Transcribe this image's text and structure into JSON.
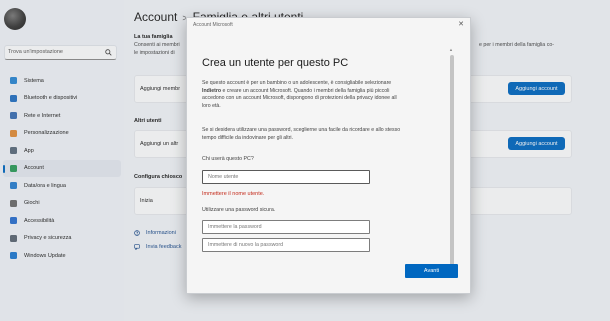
{
  "sidebar": {
    "search_placeholder": "Trova un'impostazione",
    "items": [
      {
        "label": "Sistema",
        "icon": "monitor-icon",
        "color": "#2b87d3"
      },
      {
        "label": "Bluetooth e dispositivi",
        "icon": "bluetooth-icon",
        "color": "#2470c2"
      },
      {
        "label": "Rete e Internet",
        "icon": "wifi-icon",
        "color": "#3b6fb3"
      },
      {
        "label": "Personalizzazione",
        "icon": "brush-icon",
        "color": "#e08c3a"
      },
      {
        "label": "App",
        "icon": "apps-icon",
        "color": "#5b6b7d"
      },
      {
        "label": "Account",
        "icon": "person-icon",
        "color": "#2d9b5a",
        "active": true
      },
      {
        "label": "Data/ora e lingua",
        "icon": "globe-clock-icon",
        "color": "#2a7fd0"
      },
      {
        "label": "Giochi",
        "icon": "controller-icon",
        "color": "#6b6b6b"
      },
      {
        "label": "Accessibilità",
        "icon": "accessibility-icon",
        "color": "#2a6fcf"
      },
      {
        "label": "Privacy e sicurezza",
        "icon": "shield-icon",
        "color": "#5b6673"
      },
      {
        "label": "Windows Update",
        "icon": "update-icon",
        "color": "#1f79d1"
      }
    ]
  },
  "main": {
    "breadcrumb_parent": "Account",
    "breadcrumb_separator": ">",
    "breadcrumb_current": "Famiglia e altri utenti",
    "family_title": "La tua famiglia",
    "family_desc_1": "Consenti ai membri",
    "family_desc_2": "le impostazioni di",
    "family_desc_right": "e per i membri della famiglia co-",
    "add_member_label": "Aggiungi membr",
    "add_account_label": "Aggiungi account",
    "others_title": "Altri utenti",
    "add_other_label": "Aggiungi un altr",
    "kiosk_title": "Configura chiosco",
    "kiosk_label": "Inizia",
    "info_link": "Informazioni",
    "feedback_link": "Invia feedback"
  },
  "dialog": {
    "window_title": "Account Microsoft",
    "close_label": "✕",
    "heading": "Crea un utente per questo PC",
    "para1_lines": [
      "Se questo account è per un bambino o un adolescente, è consigliabile selezionare",
      "Indietro e creare un account Microsoft. Quando i membri della famiglia più piccoli",
      "accedono con un account Microsoft, dispongono di protezioni della privacy idonee all",
      "loro età."
    ],
    "para1_bold_word": "Indietro",
    "para2_lines": [
      "Se si desidera utilizzare una password, sceglierne una facile da ricordare e allo stesso",
      "tempo difficile da indovinare per gli altri."
    ],
    "who_label": "Chi userà questo PC?",
    "username_placeholder": "Nome utente",
    "error_text": "Immettere il nome utente.",
    "password_label": "Utilizzare una password sicura.",
    "password_placeholder": "Immettere la password",
    "password_repeat_placeholder": "Immettere di nuovo la password",
    "next_button": "Avanti"
  },
  "colors": {
    "accent": "#0067c0",
    "error": "#c42b1c"
  }
}
